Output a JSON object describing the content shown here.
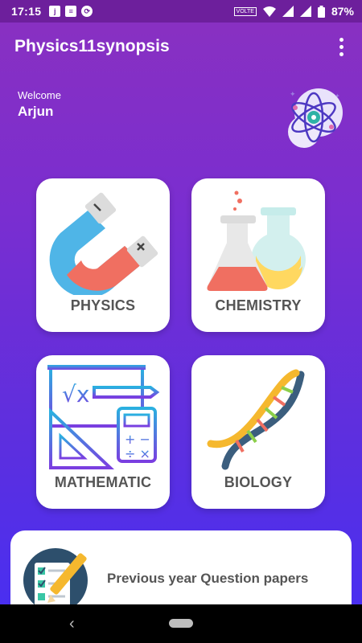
{
  "status_bar": {
    "time": "17:15",
    "notification_icons": [
      "myjio-icon",
      "message-icon",
      "sync-icon"
    ],
    "volte": "VOLTE",
    "battery": "87%"
  },
  "app_bar": {
    "title": "Physics11synopsis"
  },
  "welcome": {
    "label": "Welcome",
    "name": "Arjun"
  },
  "subjects": [
    {
      "label": "PHYSICS",
      "icon": "magnet-icon"
    },
    {
      "label": "CHEMISTRY",
      "icon": "flask-icon"
    },
    {
      "label": "MATHEMATIC",
      "icon": "math-board-icon"
    },
    {
      "label": "BIOLOGY",
      "icon": "dna-icon"
    }
  ],
  "papers": {
    "label": "Previous year Question papers",
    "icon": "exam-paper-icon"
  },
  "colors": {
    "status_bar": "#6d1f9c",
    "gradient_top": "#8a30c0",
    "gradient_bottom": "#4a2ff0",
    "card": "#ffffff",
    "card_label": "#555555"
  }
}
